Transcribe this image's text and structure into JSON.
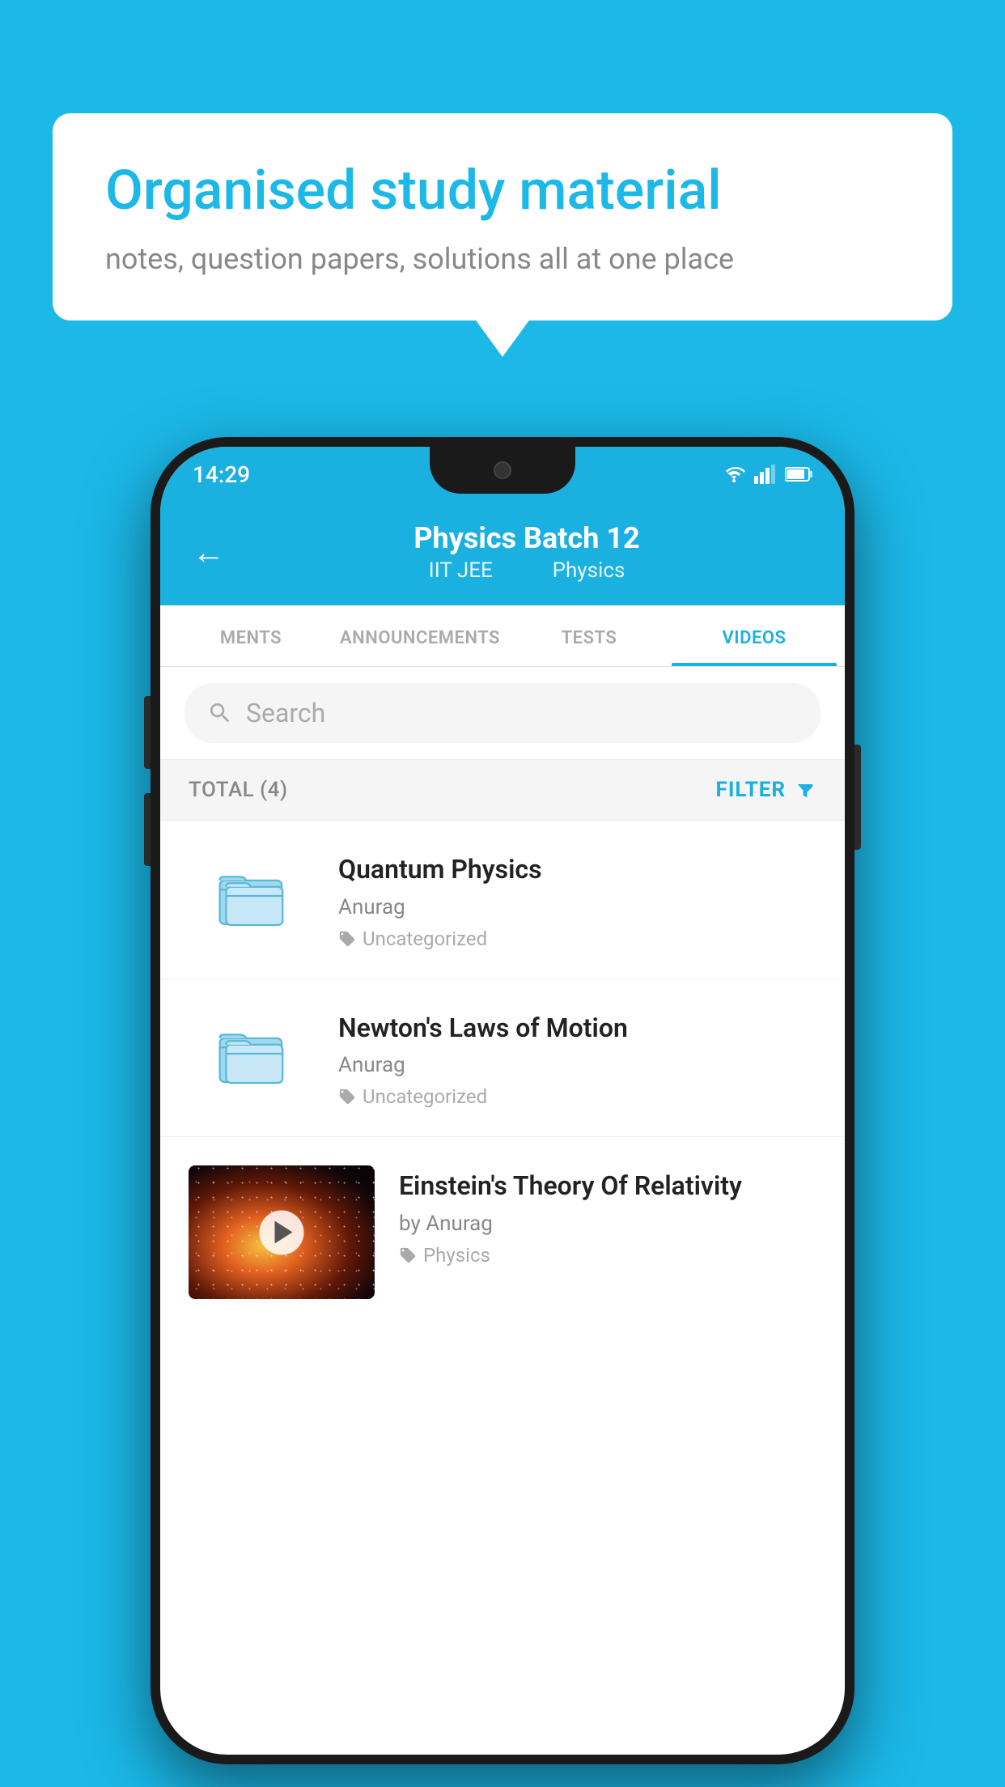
{
  "background": {
    "color": "#1bb8e8"
  },
  "hero": {
    "title": "Organised study material",
    "subtitle": "notes, question papers, solutions all at one place"
  },
  "phone": {
    "status_bar": {
      "time": "14:29",
      "icons": [
        "wifi",
        "signal",
        "battery"
      ]
    },
    "app_bar": {
      "title": "Physics Batch 12",
      "subtitle_part1": "IIT JEE",
      "subtitle_part2": "Physics",
      "back_label": "←"
    },
    "tabs": [
      {
        "label": "MENTS",
        "active": false
      },
      {
        "label": "ANNOUNCEMENTS",
        "active": false
      },
      {
        "label": "TESTS",
        "active": false
      },
      {
        "label": "VIDEOS",
        "active": true
      }
    ],
    "search": {
      "placeholder": "Search"
    },
    "filter_row": {
      "total_label": "TOTAL (4)",
      "filter_button": "FILTER"
    },
    "videos": [
      {
        "id": 1,
        "title": "Quantum Physics",
        "author": "Anurag",
        "tag": "Uncategorized",
        "has_thumbnail": false
      },
      {
        "id": 2,
        "title": "Newton's Laws of Motion",
        "author": "Anurag",
        "tag": "Uncategorized",
        "has_thumbnail": false
      },
      {
        "id": 3,
        "title": "Einstein's Theory Of Relativity",
        "author": "by Anurag",
        "tag": "Physics",
        "has_thumbnail": true
      }
    ]
  }
}
